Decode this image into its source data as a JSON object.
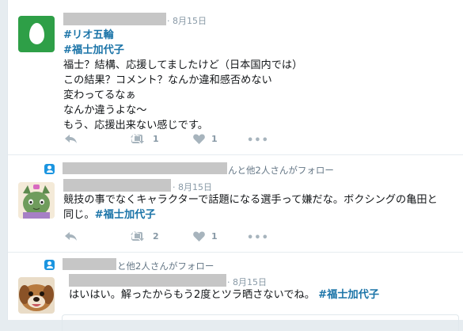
{
  "tweets": [
    {
      "date": "· 8月15日",
      "hashtag_top": "#リオ五輪",
      "hashtag_main": "#福士加代子",
      "lines": [
        "福士？結構、応援してましたけど（日本国内では）",
        "この結果？コメント？なんか違和感否めない",
        "変わってるなぁ",
        "なんか違うよな〜",
        "もう、応援出来ない感じです。"
      ],
      "retweets": "1",
      "likes": "1",
      "more": "•••"
    },
    {
      "social_context": "んと他2人さんがフォロー",
      "date": "· 8月15日",
      "line1": "競技の事でなくキャラクターで話題になる選手って嫌だな。ボクシングの亀田と",
      "line2_text": "同じ。",
      "hashtag": "#福士加代子",
      "retweets": "2",
      "likes": "1",
      "more": "•••"
    },
    {
      "social_context": "と他2人さんがフォロー",
      "date": "· 8月15日",
      "text": "はいはい。解ったからもう2度とツラ晒さないでね。",
      "hashtag": "#福士加代子"
    }
  ],
  "colors": {
    "hashtag": "#1b74a8",
    "follow_icon": "#1b95e0",
    "egg_avatar": "#2e9f47"
  }
}
